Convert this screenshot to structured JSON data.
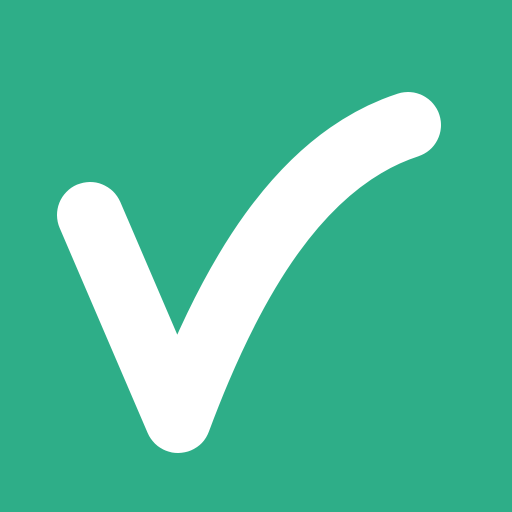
{
  "icon": {
    "name": "checkmark-icon",
    "colors": {
      "background": "#2EAE88",
      "checkmark": "#FFFFFF"
    }
  }
}
